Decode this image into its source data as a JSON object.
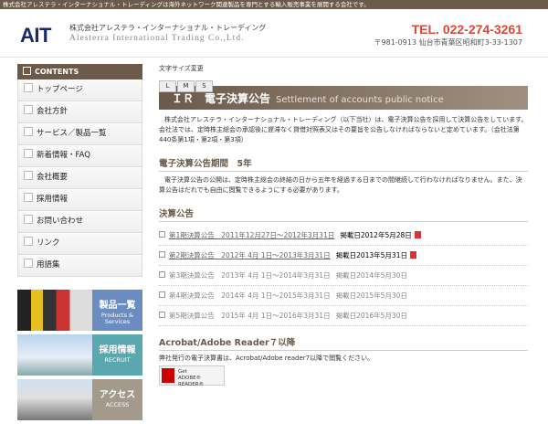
{
  "topbar": {
    "text": "株式会社アレステラ・インターナショナル・トレーディングは海外ネットワーク関連製品を専門とする輸入販売事業を展開する会社です。"
  },
  "header": {
    "logo": "AIT",
    "company_jp": "株式会社アレステラ・インターナショナル・トレーディング",
    "company_en": "Alesterra International Trading Co.,Ltd.",
    "tel": "TEL. 022-274-3261",
    "address": "〒981-0913 仙台市青葉区昭和町3-33-1307"
  },
  "sidebar": {
    "heading": "CONTENTS",
    "items": [
      "トップページ",
      "会社方針",
      "サービス／製品一覧",
      "新着情報・FAQ",
      "会社概要",
      "採用情報",
      "お問い合わせ",
      "リンク",
      "用語集"
    ],
    "banners": [
      {
        "title": "製品一覧",
        "subtitle": "Products & Services"
      },
      {
        "title": "採用情報",
        "subtitle": "RECRUIT"
      },
      {
        "title": "アクセス",
        "subtitle": "ACCESS"
      }
    ]
  },
  "fontsize": {
    "label": "文字サイズ変更",
    "buttons": [
      "L",
      "M",
      "S"
    ]
  },
  "page": {
    "title_jp": "ＩＲ　電子決算公告",
    "title_en": "Settlement of accounts public notice",
    "intro": "株式会社アレステラ・インターナショナル・トレーディング（以下当社）は、電子決算公告を採用して決算公告をしています。会社法では、定時株主総会の承認後に遅滞なく貸借対照表又はその要旨を公告しなければならないと定めています。（会社法第440条第1項・第2項・第3項）",
    "section1_title": "電子決算公告期間　5年",
    "section1_text": "電子決算公告の公開は、定時株主総会の終結の日から五年を経過する日までの間継続して行わなければなりません。また、決算公告はだれでも自由に閲覧できるようにする必要があります。",
    "section2_title": "決算公告",
    "notices": [
      {
        "link": "第1期決算公告　2011年12月27日～2012年3月31日",
        "published": "掲載日2012年5月28日",
        "pdf": true
      },
      {
        "link": "第2期決算公告　2012年 4月 1日～2013年3月31日",
        "published": "掲載日2013年5月31日",
        "pdf": true
      },
      {
        "link": "第3期決算公告　2013年 4月 1日～2014年3月31日",
        "published": "掲載日2014年5月30日",
        "pdf": false
      },
      {
        "link": "第4期決算公告　2014年 4月 1日～2015年3月31日",
        "published": "掲載日2015年5月30日",
        "pdf": false
      },
      {
        "link": "第5期決算公告　2015年 4月 1日～2016年3月31日",
        "published": "掲載日2016年5月30日",
        "pdf": false
      }
    ],
    "section3_title": "Acrobat/Adobe Reader７以降",
    "section3_text": "弊社発行の電子決算書は、Acrobat/Adobe reader7以降で閲覧ください。",
    "get_button_line1": "Get",
    "get_button_line2": "ADOBE® READER®"
  }
}
